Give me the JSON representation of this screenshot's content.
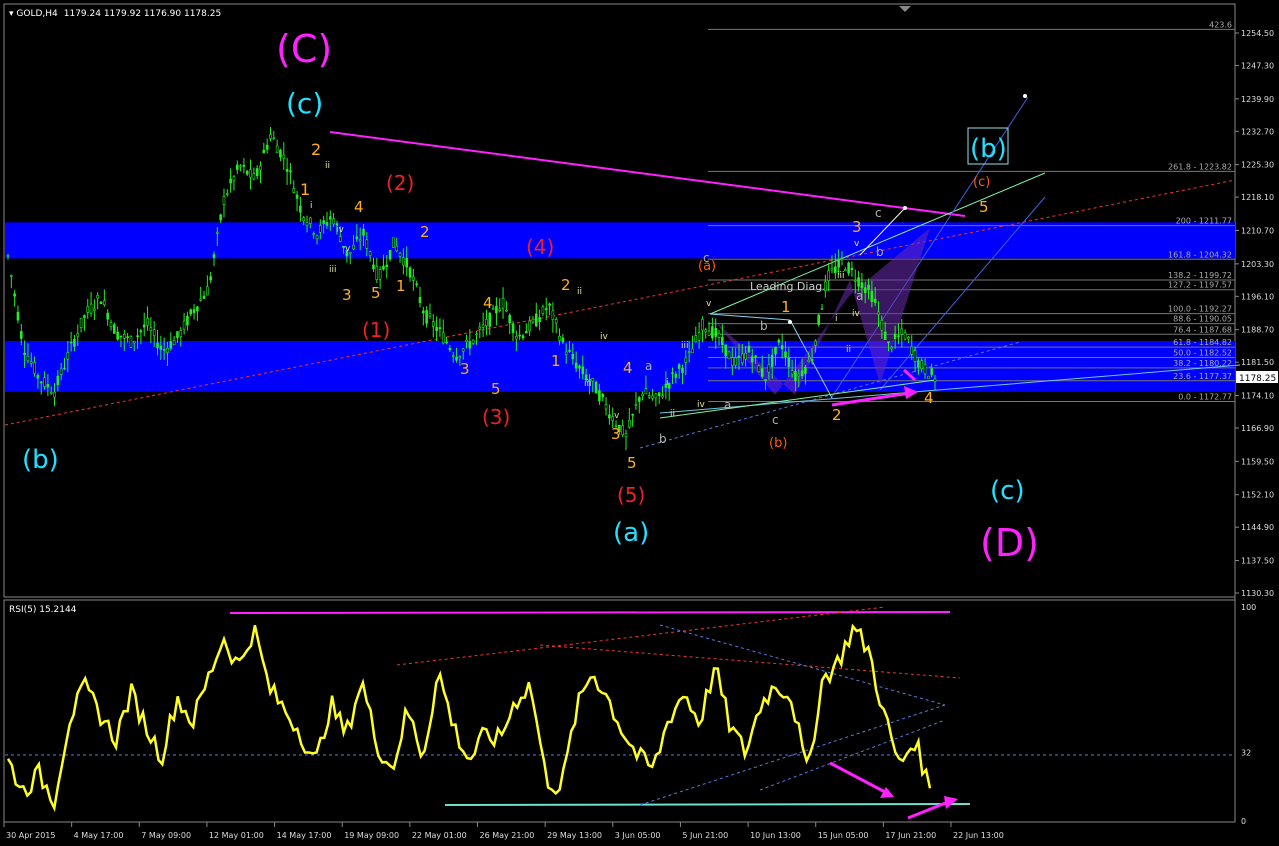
{
  "header": {
    "symbol": "GOLD,H4",
    "ohlc": "1179.24 1179.92 1176.90 1178.25"
  },
  "price_axis": {
    "labels": [
      "1254.50",
      "1247.30",
      "1239.90",
      "1232.70",
      "1225.30",
      "1218.10",
      "1210.70",
      "1203.30",
      "1196.10",
      "1188.70",
      "1181.50",
      "1174.10",
      "1166.90",
      "1159.50",
      "1152.10",
      "1144.90",
      "1137.50",
      "1130.30"
    ],
    "current_price": "1178.25"
  },
  "rsi": {
    "title": "RSI(5) 15.2144",
    "levels": [
      "100",
      "32",
      "0"
    ]
  },
  "time_axis": [
    "30 Apr 2015",
    "4 May 17:00",
    "7 May 09:00",
    "12 May 01:00",
    "14 May 17:00",
    "19 May 09:00",
    "22 May 01:00",
    "26 May 21:00",
    "29 May 13:00",
    "3 Jun 05:00",
    "5 Jun 21:00",
    "10 Jun 13:00",
    "15 Jun 05:00",
    "17 Jun 21:00",
    "22 Jun 13:00"
  ],
  "fib_labels": [
    "423.6",
    "261.8 - 1223.82",
    "200 - 1211.77",
    "161.8 - 1204.32",
    "138.2 - 1199.72",
    "127.2 - 1197.57",
    "100.0 - 1192.27",
    "88.6 - 1190.05",
    "76.4 - 1187.68",
    "61.8 - 1184.82",
    "50.0 - 1182.52",
    "38.2 - 1180.22",
    "23.6 - 1177.37",
    "0.0 - 1172.77"
  ],
  "colors": {
    "background": "#000000",
    "candle": "#22ee22",
    "support_zone": "#0000ff",
    "rsi_line": "#ffff22",
    "magenta": "#ff22ff",
    "cyan": "#22e0ff",
    "orange": "#ffb020",
    "red": "#ee2222",
    "darkorange": "#ff5a10"
  },
  "chart_data": {
    "type": "candlestick",
    "symbol": "GOLD",
    "timeframe": "H4",
    "ylim": [
      1127.5,
      1260.0
    ],
    "x": [
      "30 Apr 2015",
      "4 May 17:00",
      "7 May 09:00",
      "12 May 01:00",
      "14 May 17:00",
      "19 May 09:00",
      "22 May 01:00",
      "26 May 21:00",
      "29 May 13:00",
      "3 Jun 05:00",
      "5 Jun 21:00",
      "10 Jun 13:00",
      "15 Jun 05:00",
      "17 Jun 21:00",
      "22 Jun 13:00"
    ],
    "close_path": [
      1205,
      1185,
      1178,
      1175,
      1184,
      1192,
      1196,
      1188,
      1186,
      1190,
      1184,
      1187,
      1193,
      1198,
      1218,
      1225,
      1222,
      1232,
      1226,
      1215,
      1210,
      1214,
      1205,
      1210,
      1200,
      1208,
      1202,
      1192,
      1188,
      1183,
      1186,
      1190,
      1195,
      1187,
      1190,
      1194,
      1185,
      1180,
      1176,
      1170,
      1165,
      1175,
      1173,
      1178,
      1182,
      1190,
      1187,
      1181,
      1184,
      1178,
      1186,
      1178,
      1182,
      1200,
      1204,
      1200,
      1196,
      1185,
      1188,
      1181,
      1178
    ],
    "support_zones": [
      [
        1204.5,
        1212.5
      ],
      [
        1174.9,
        1186.2
      ]
    ],
    "rsi_series": [
      28,
      14,
      22,
      10,
      48,
      62,
      50,
      38,
      60,
      44,
      30,
      58,
      46,
      66,
      86,
      72,
      90,
      62,
      52,
      42,
      26,
      55,
      40,
      66,
      36,
      24,
      52,
      30,
      70,
      44,
      28,
      40,
      38,
      56,
      64,
      20,
      15,
      52,
      70,
      58,
      42,
      30,
      24,
      48,
      60,
      46,
      72,
      44,
      32,
      55,
      64,
      58,
      22,
      66,
      74,
      90,
      80,
      50,
      26,
      38,
      15
    ],
    "rsi_levels": [
      0,
      32,
      100
    ]
  },
  "annotations": {
    "C_big": "(C)",
    "c_top": "(c)",
    "b_left": "(b)",
    "w2_top": "2",
    "w1_top": "1",
    "w2_red": "(2)",
    "w4_red": "(4)",
    "w1_red": "(1)",
    "w3_red": "(3)",
    "w5_red": "(5)",
    "wa_cyan": "(a)",
    "wb_cyan": "(b)",
    "wc_cyan": "(c)",
    "D_big": "(D)",
    "a_orange": "(a)",
    "b_orange": "(b)",
    "c_orange": "(c)",
    "leading_diag": "Leading Diag.",
    "n3a": "3",
    "n5a": "5",
    "n1a": "1",
    "n4a": "4",
    "n2a": "2",
    "n3b": "3",
    "n4b": "4",
    "n5b": "5",
    "n2b": "2",
    "n1b": "1",
    "n4c": "4",
    "n3c": "3",
    "n5c": "5",
    "n1c": "1",
    "n2c": "2",
    "n3d": "3",
    "n4d": "4",
    "n5d": "5",
    "r_i": "i",
    "r_ii": "ii",
    "r_iii": "iii",
    "r_iv": "iv",
    "r_v": "v",
    "r_ii2": "ii",
    "r_iv2": "iv",
    "r_iii2": "iii",
    "r_v2": "v",
    "r_iii3": "iii",
    "r_i2": "i",
    "r_ii3": "ii",
    "r_iv3": "iv",
    "r_v3": "v",
    "r_i3": "i",
    "r_ii4": "ii",
    "r_iii4": "iii",
    "r_iv4": "iv",
    "r_v4": "v",
    "a_sm": "a",
    "b_sm": "b",
    "c_sm": "c",
    "a_sm2": "a",
    "b_sm2": "b",
    "c_sm2": "c",
    "a_sm3": "a",
    "b_sm3": "b",
    "c_sm3": "c"
  }
}
